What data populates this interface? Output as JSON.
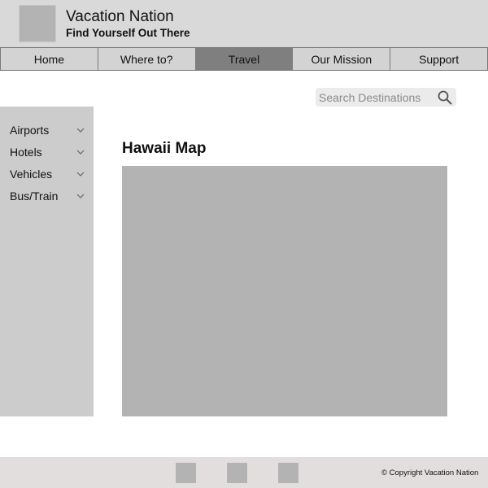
{
  "header": {
    "title": "Vacation Nation",
    "tagline": "Find Yourself Out There"
  },
  "nav": {
    "items": [
      {
        "label": "Home"
      },
      {
        "label": "Where to?"
      },
      {
        "label": "Travel"
      },
      {
        "label": "Our Mission"
      },
      {
        "label": "Support"
      }
    ],
    "active": "Travel"
  },
  "search": {
    "placeholder": "Search Destinations",
    "value": ""
  },
  "sidebar": {
    "items": [
      {
        "label": "Airports"
      },
      {
        "label": "Hotels"
      },
      {
        "label": "Vehicles"
      },
      {
        "label": "Bus/Train"
      }
    ]
  },
  "main": {
    "title": "Hawaii Map"
  },
  "footer": {
    "copyright": "© Copyright Vacation Nation"
  },
  "colors": {
    "header_bg": "#d9d9d9",
    "nav_bg": "#d3d3d3",
    "nav_active_bg": "#7f7f7f",
    "placeholder_block": "#b3b3b3",
    "sidebar_bg": "#cccccc",
    "footer_bg": "#e2dede"
  },
  "icons": {
    "search": "search-icon",
    "chevron": "chevron-down-icon"
  }
}
